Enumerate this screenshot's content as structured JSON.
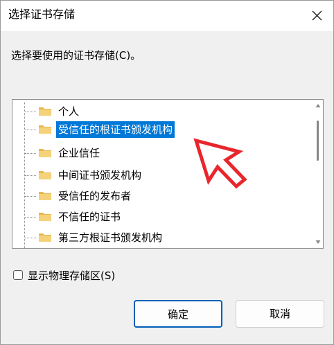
{
  "window": {
    "title": "选择证书存储",
    "close_icon": "close-icon"
  },
  "prompt": "选择要使用的证书存储(C)。",
  "tree": {
    "items": [
      {
        "label": "个人",
        "selected": false
      },
      {
        "label": "受信任的根证书颁发机构",
        "selected": true
      },
      {
        "label": "企业信任",
        "selected": false
      },
      {
        "label": "中间证书颁发机构",
        "selected": false
      },
      {
        "label": "受信任的发布者",
        "selected": false
      },
      {
        "label": "不信任的证书",
        "selected": false
      },
      {
        "label": "第三方根证书颁发机构",
        "selected": false
      }
    ],
    "selection_color": "#0078d7",
    "folder_color": "#f5d27a"
  },
  "checkbox": {
    "label": "显示物理存储区(S)",
    "checked": false
  },
  "buttons": {
    "ok_label": "确定",
    "cancel_label": "取消"
  },
  "annotation": {
    "arrow_color": "#e8262c"
  }
}
